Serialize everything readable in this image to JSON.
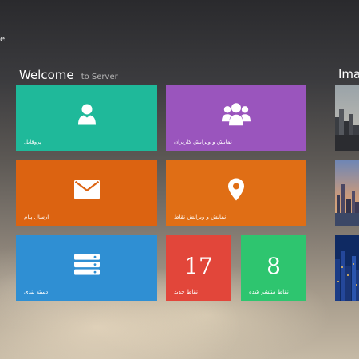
{
  "corner_label": "el",
  "header": {
    "title": "Welcome",
    "subtitle": "to Server",
    "images_title": "Imag"
  },
  "tiles": {
    "profile": {
      "label": "پروفایل",
      "color": "#1fb99a",
      "icon": "user-icon"
    },
    "users": {
      "label": "نمایش و ویرایش کاربران",
      "color": "#9a55bd",
      "icon": "users-icon"
    },
    "message": {
      "label": "ارسال پیام",
      "color": "#dc6311",
      "icon": "envelope-icon"
    },
    "points": {
      "label": "نمایش و ویرایش نقاط",
      "color": "#e06e15",
      "icon": "map-marker-icon"
    },
    "category": {
      "label": "دسته بندی",
      "color": "#2f8fd3",
      "icon": "server-icon"
    },
    "new_points": {
      "label": "نقاط جدید",
      "value": "17",
      "color": "#e2463a"
    },
    "published_points": {
      "label": "نقاط منتشر شده",
      "value": "8",
      "color": "#2ec56f"
    }
  },
  "images": [
    {
      "name": "city-skyline-day"
    },
    {
      "name": "city-skyline-sunset"
    },
    {
      "name": "city-skyline-night"
    }
  ]
}
